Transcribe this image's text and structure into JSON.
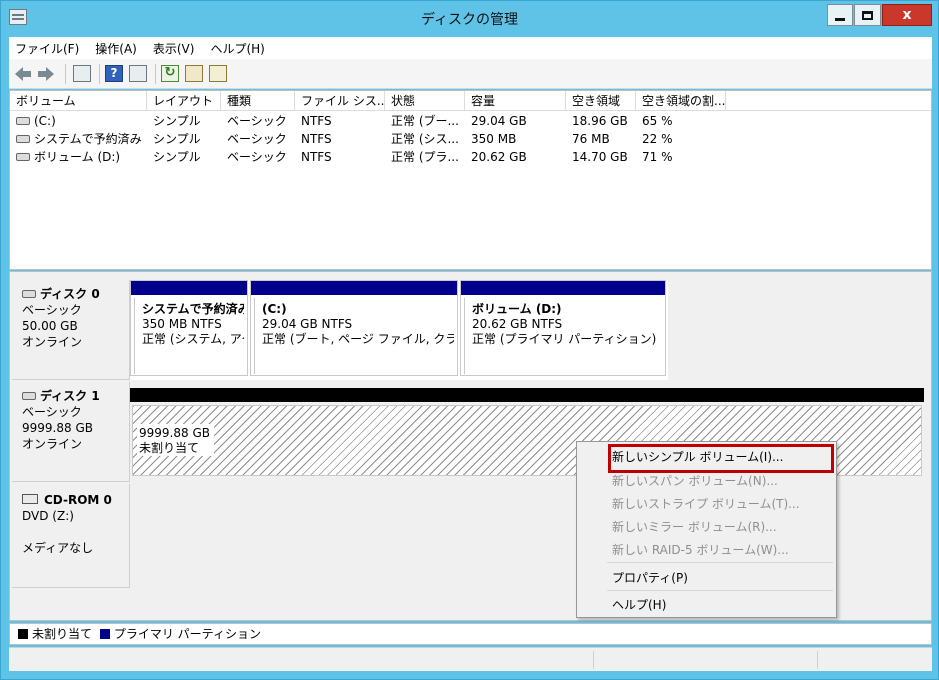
{
  "window": {
    "title": "ディスクの管理",
    "close_glyph": "x"
  },
  "menubar": {
    "items": [
      "ファイル(F)",
      "操作(A)",
      "表示(V)",
      "ヘルプ(H)"
    ]
  },
  "toolbar": {
    "icons": [
      "back-arrow-icon",
      "forward-arrow-icon",
      "console-tree-icon",
      "help-icon",
      "details-pane-icon",
      "refresh-icon",
      "properties-icon",
      "rescan-icon"
    ],
    "help_glyph": "?",
    "refresh_glyph": "↻"
  },
  "volume_list": {
    "columns": [
      "ボリューム",
      "レイアウト",
      "種類",
      "ファイル シス...",
      "状態",
      "容量",
      "空き領域",
      "空き領域の割..."
    ],
    "rows": [
      [
        "(C:)",
        "シンプル",
        "ベーシック",
        "NTFS",
        "正常 (ブー...",
        "29.04 GB",
        "18.96 GB",
        "65 %"
      ],
      [
        "システムで予約済み",
        "シンプル",
        "ベーシック",
        "NTFS",
        "正常 (シス...",
        "350 MB",
        "76 MB",
        "22 %"
      ],
      [
        "ボリューム (D:)",
        "シンプル",
        "ベーシック",
        "NTFS",
        "正常 (プラ...",
        "20.62 GB",
        "14.70 GB",
        "71 %"
      ]
    ]
  },
  "disks": {
    "disk0": {
      "name": "ディスク 0",
      "type": "ベーシック",
      "size": "50.00 GB",
      "status": "オンライン",
      "partitions": [
        {
          "name": "システムで予約済み",
          "size": "350 MB NTFS",
          "status": "正常 (システム, アク"
        },
        {
          "name": "(C:)",
          "size": "29.04 GB NTFS",
          "status": "正常 (ブート, ページ ファイル, クラッシュ"
        },
        {
          "name": "ボリューム (D:)",
          "size": "20.62 GB NTFS",
          "status": "正常 (プライマリ パーティション)"
        }
      ]
    },
    "disk1": {
      "name": "ディスク 1",
      "type": "ベーシック",
      "size": "9999.88 GB",
      "status": "オンライン",
      "unallocated_size": "9999.88 GB",
      "unallocated_label": "未割り当て"
    },
    "cdrom0": {
      "name": "CD-ROM 0",
      "drive": "DVD (Z:)",
      "status": "メディアなし"
    }
  },
  "legend": {
    "unallocated": "未割り当て",
    "primary": "プライマリ パーティション",
    "unallocated_color": "#000000",
    "primary_color": "#00008c"
  },
  "context_menu": {
    "new_simple": "新しいシンプル ボリューム(I)...",
    "new_spanned": "新しいスパン ボリューム(N)...",
    "new_striped": "新しいストライプ ボリューム(T)...",
    "new_mirror": "新しいミラー ボリューム(R)...",
    "new_raid5": "新しい RAID-5 ボリューム(W)...",
    "properties": "プロパティ(P)",
    "help": "ヘルプ(H)",
    "highlight_color": "#c00000"
  }
}
